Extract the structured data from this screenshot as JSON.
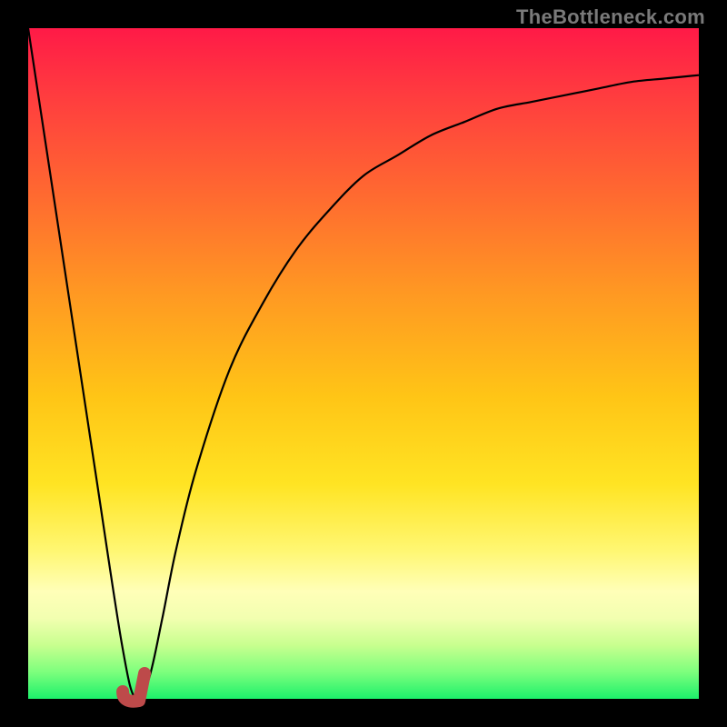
{
  "watermark": {
    "text": "TheBottleneck.com"
  },
  "chart_data": {
    "type": "line",
    "title": "",
    "xlabel": "",
    "ylabel": "",
    "xlim": [
      0,
      100
    ],
    "ylim": [
      0,
      100
    ],
    "grid": false,
    "series": [
      {
        "name": "bottleneck-curve",
        "color": "#000000",
        "x": [
          0,
          5,
          10,
          14,
          16,
          18,
          20,
          22,
          25,
          30,
          35,
          40,
          45,
          50,
          55,
          60,
          65,
          70,
          75,
          80,
          85,
          90,
          95,
          100
        ],
        "values": [
          100,
          67,
          34,
          8,
          0,
          3,
          12,
          22,
          34,
          49,
          59,
          67,
          73,
          78,
          81,
          84,
          86,
          88,
          89,
          90,
          91,
          92,
          92.5,
          93
        ]
      }
    ],
    "annotations": [
      {
        "name": "optimal-marker",
        "color": "#bd4a4a",
        "shape": "j-mark",
        "at_x": 16,
        "at_y": 0
      }
    ],
    "background_gradient": {
      "top": "#ff1a47",
      "mid": "#ffe423",
      "bottom": "#1cf06b"
    }
  }
}
